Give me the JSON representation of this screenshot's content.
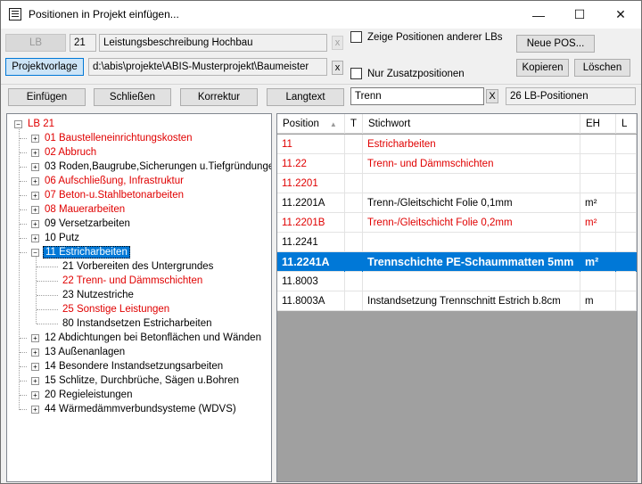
{
  "window": {
    "title": "Positionen in Projekt einfügen...",
    "minimize": "—",
    "maximize": "☐",
    "close": "✕"
  },
  "top": {
    "lb_button": "LB",
    "lb_number": "21",
    "lb_name": "Leistungsbeschreibung Hochbau",
    "clear_lb": "x",
    "projektvorlage_button": "Projektvorlage",
    "project_path": "d:\\abis\\projekte\\ABIS-Musterprojekt\\Baumeister",
    "clear_path": "x",
    "show_other_lbs": "Zeige Positionen anderer LBs",
    "only_additional": "Nur Zusatzpositionen",
    "neue_pos": "Neue POS...",
    "kopieren": "Kopieren",
    "loeschen": "Löschen"
  },
  "toolbar": {
    "einfuegen": "Einfügen",
    "schliessen": "Schließen",
    "korrektur": "Korrektur",
    "langtext": "Langtext",
    "search_value": "Trenn",
    "clear_search": "X",
    "count": "26 LB-Positionen"
  },
  "tree": {
    "root": "LB 21",
    "items": [
      {
        "label": "01 Baustelleneinrichtungskosten",
        "red": true
      },
      {
        "label": "02 Abbruch",
        "red": true
      },
      {
        "label": "03 Roden,Baugrube,Sicherungen u.Tiefgründungen",
        "red": false
      },
      {
        "label": "06 Aufschließung, Infrastruktur",
        "red": true
      },
      {
        "label": "07 Beton-u.Stahlbetonarbeiten",
        "red": true
      },
      {
        "label": "08 Mauerarbeiten",
        "red": true
      },
      {
        "label": "09 Versetzarbeiten",
        "red": false
      },
      {
        "label": "10 Putz",
        "red": false
      },
      {
        "label": "11 Estricharbeiten",
        "red": false,
        "selected": true
      },
      {
        "label": "12 Abdichtungen bei Betonflächen und Wänden",
        "red": false
      },
      {
        "label": "13 Außenanlagen",
        "red": false
      },
      {
        "label": "14 Besondere Instandsetzungsarbeiten",
        "red": false
      },
      {
        "label": "15 Schlitze, Durchbrüche, Sägen u.Bohren",
        "red": false
      },
      {
        "label": "20 Regieleistungen",
        "red": false
      },
      {
        "label": "44 Wärmedämmverbundsysteme (WDVS)",
        "red": false
      }
    ],
    "children": [
      {
        "label": "21 Vorbereiten des Untergrundes",
        "red": false
      },
      {
        "label": "22 Trenn- und Dämmschichten",
        "red": true
      },
      {
        "label": "23 Nutzestriche",
        "red": false
      },
      {
        "label": "25 Sonstige Leistungen",
        "red": true
      },
      {
        "label": "80 Instandsetzen Estricharbeiten",
        "red": false
      }
    ]
  },
  "grid": {
    "columns": [
      "Position",
      "T",
      "Stichwort",
      "EH",
      "L"
    ],
    "sort_indicator": "▲",
    "rows": [
      {
        "position": "11",
        "t": "",
        "stichwort": "Estricharbeiten",
        "eh": "",
        "l": "",
        "red": true
      },
      {
        "position": "11.22",
        "t": "",
        "stichwort": "Trenn- und Dämmschichten",
        "eh": "",
        "l": "",
        "red": true
      },
      {
        "position": "11.2201",
        "t": "",
        "stichwort": "",
        "eh": "",
        "l": "",
        "red": true
      },
      {
        "position": "11.2201A",
        "t": "",
        "stichwort": "Trenn-/Gleitschicht Folie 0,1mm",
        "eh": "m²",
        "l": "",
        "red": false
      },
      {
        "position": "11.2201B",
        "t": "",
        "stichwort": "Trenn-/Gleitschicht Folie 0,2mm",
        "eh": "m²",
        "l": "",
        "red": true
      },
      {
        "position": "11.2241",
        "t": "",
        "stichwort": "",
        "eh": "",
        "l": "",
        "red": false
      },
      {
        "position": "11.2241A",
        "t": "",
        "stichwort": "Trennschichte PE-Schaummatten 5mm",
        "eh": "m²",
        "l": "",
        "red": false,
        "selected": true
      },
      {
        "position": "11.8003",
        "t": "",
        "stichwort": "",
        "eh": "",
        "l": "",
        "red": false
      },
      {
        "position": "11.8003A",
        "t": "",
        "stichwort": "Instandsetzung Trennschnitt Estrich b.8cm",
        "eh": "m",
        "l": "",
        "red": false
      }
    ]
  },
  "colors": {
    "accent": "#0078d7",
    "red_text": "#e00000",
    "grid_empty": "#a0a0a0"
  }
}
